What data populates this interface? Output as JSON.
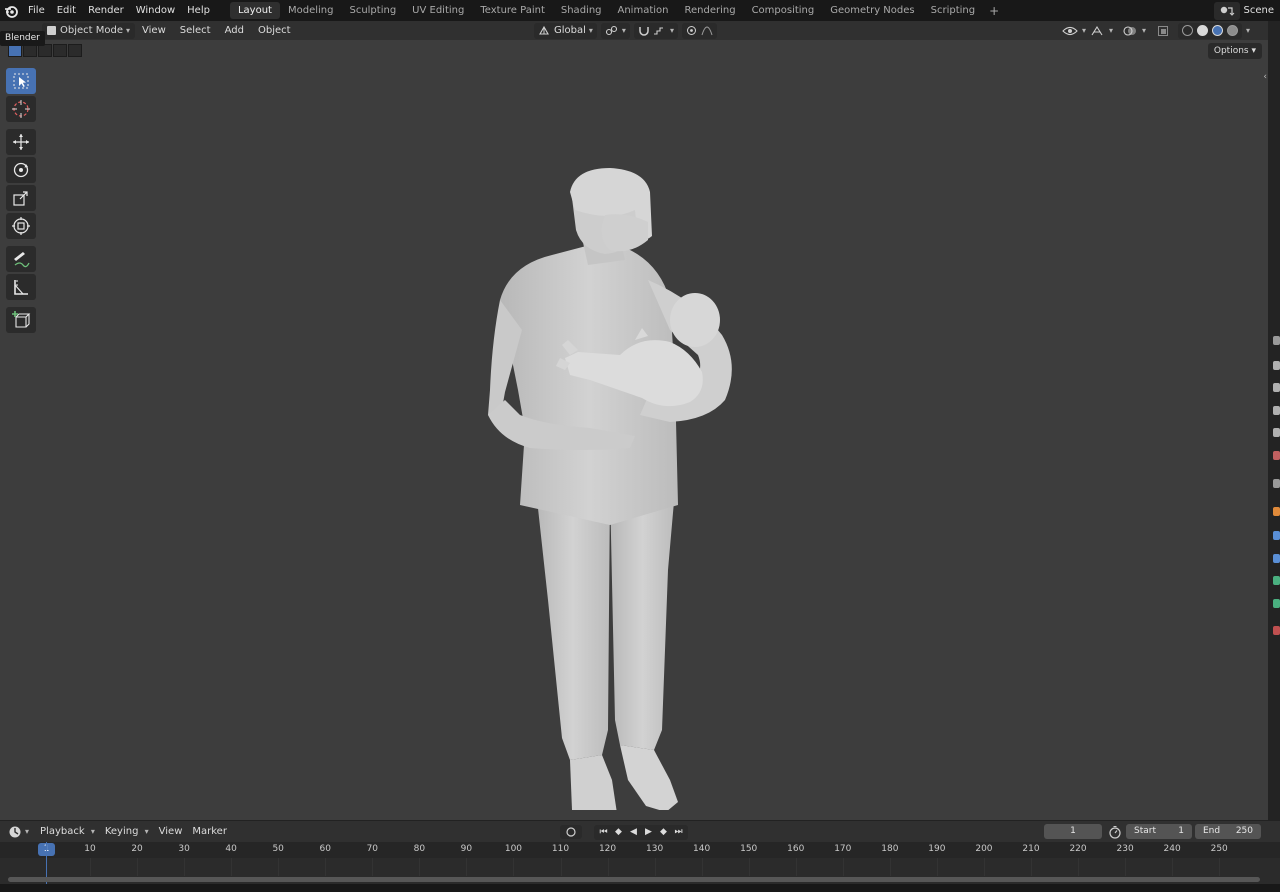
{
  "topbar": {
    "menus": [
      "File",
      "Edit",
      "Render",
      "Window",
      "Help"
    ],
    "workspaces": [
      "Layout",
      "Modeling",
      "Sculpting",
      "UV Editing",
      "Texture Paint",
      "Shading",
      "Animation",
      "Rendering",
      "Compositing",
      "Geometry Nodes",
      "Scripting"
    ],
    "add_tab": "+",
    "scene_label": "Scene"
  },
  "tooltip": "Blender",
  "viewport_header": {
    "mode": "Object Mode",
    "menus": [
      "View",
      "Select",
      "Add",
      "Object"
    ],
    "transform_orientation": "Global",
    "options_label": "Options"
  },
  "timeline": {
    "menus": [
      "Playback",
      "Keying",
      "View",
      "Marker"
    ],
    "current_frame": "1",
    "start_label": "Start",
    "start_value": "1",
    "end_label": "End",
    "end_value": "250",
    "ruler_labels": [
      "1",
      "10",
      "20",
      "30",
      "40",
      "50",
      "60",
      "70",
      "80",
      "90",
      "100",
      "110",
      "120",
      "130",
      "140",
      "150",
      "160",
      "170",
      "180",
      "190",
      "200",
      "210",
      "220",
      "230",
      "240",
      "250"
    ]
  },
  "colors": {
    "accent": "#4772b3",
    "viewport_bg": "#3d3d3d",
    "header_bg": "#303030",
    "topbar_bg": "#181818",
    "model_gray": "#cdcdcd"
  },
  "icons": {
    "toolbar": [
      "select-box-icon",
      "cursor-icon",
      "move-icon",
      "rotate-icon",
      "scale-icon",
      "transform-icon",
      "annotate-icon",
      "measure-icon",
      "add-cube-icon"
    ]
  }
}
